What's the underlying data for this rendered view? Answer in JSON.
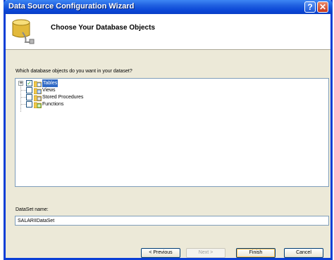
{
  "window": {
    "title": "Data Source Configuration Wizard",
    "help_glyph": "?",
    "close_glyph": "✕"
  },
  "header": {
    "heading": "Choose Your Database Objects",
    "icon": "database-icon"
  },
  "prompt": "Which database objects do you want in your dataset?",
  "tree": {
    "expander_glyph": "+",
    "items": [
      {
        "label": "Tables",
        "checked": true,
        "selected": true,
        "icon": "tables-folder-icon",
        "expandable": true
      },
      {
        "label": "Views",
        "checked": false,
        "selected": false,
        "icon": "views-folder-icon"
      },
      {
        "label": "Stored Procedures",
        "checked": false,
        "selected": false,
        "icon": "stored-procedures-folder-icon"
      },
      {
        "label": "Functions",
        "checked": false,
        "selected": false,
        "icon": "functions-folder-icon"
      }
    ],
    "check_glyph": "✓"
  },
  "dataset": {
    "label": "DataSet name:",
    "value": "SALARIIDataSet"
  },
  "buttons": {
    "previous": "< Previous",
    "next": "Next >",
    "finish": "Finish",
    "cancel": "Cancel"
  },
  "colors": {
    "titlebar": "#0b46d6",
    "selection": "#316ac5",
    "face": "#ece9d8"
  }
}
